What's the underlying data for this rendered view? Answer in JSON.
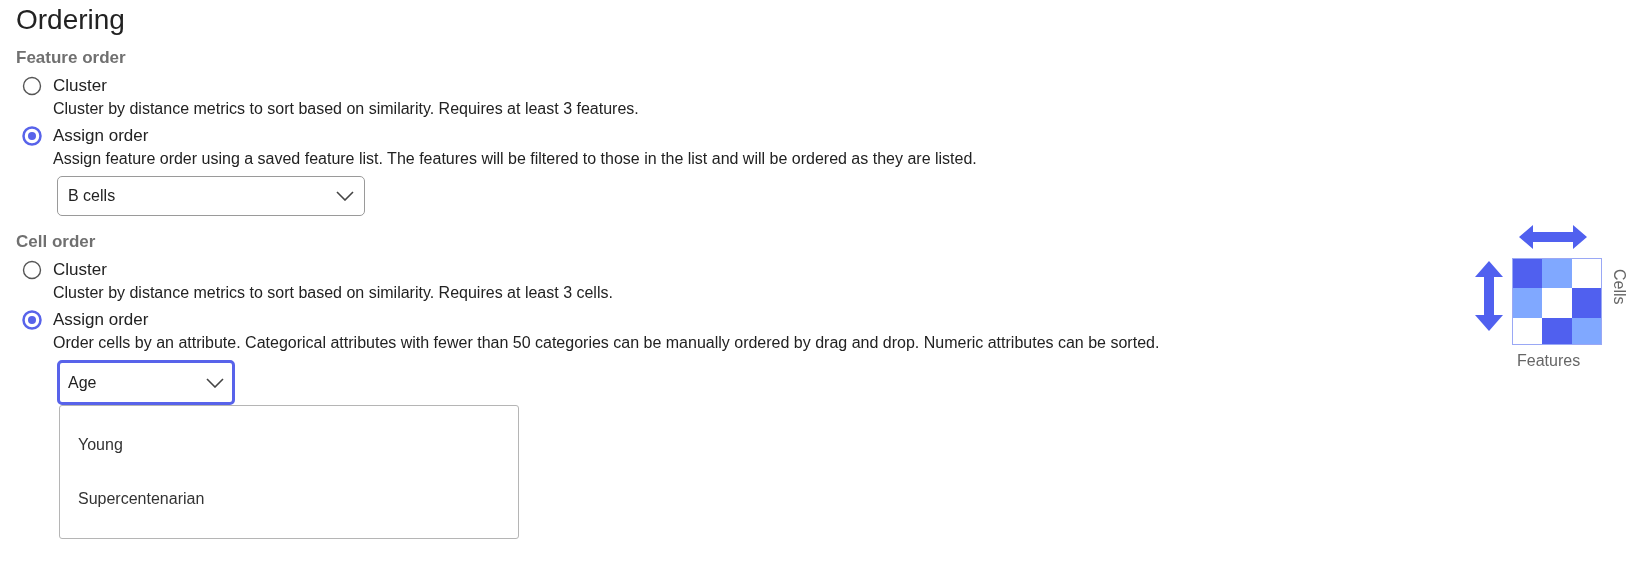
{
  "title": "Ordering",
  "sections": [
    {
      "heading": "Feature order",
      "options": [
        {
          "label": "Cluster",
          "description": "Cluster by distance metrics to sort based on similarity. Requires at least 3 features.",
          "selected": false
        },
        {
          "label": "Assign order",
          "description": "Assign feature order using a saved feature list. The features will be filtered to those in the list and will be ordered as they are listed.",
          "selected": true,
          "select": {
            "value": "B cells",
            "expanded": false
          }
        }
      ]
    },
    {
      "heading": "Cell order",
      "options": [
        {
          "label": "Cluster",
          "description": "Cluster by distance metrics to sort based on similarity. Requires at least 3 cells.",
          "selected": false
        },
        {
          "label": "Assign order",
          "description": "Order cells by an attribute. Categorical attributes with fewer than 50 categories can be manually ordered by drag and drop. Numeric attributes can be sorted.",
          "selected": true,
          "select": {
            "value": "Age",
            "expanded": true,
            "options": [
              "Young",
              "Supercentenarian"
            ]
          }
        }
      ]
    }
  ],
  "diagram": {
    "side_label": "Cells",
    "bottom_label": "Features"
  }
}
